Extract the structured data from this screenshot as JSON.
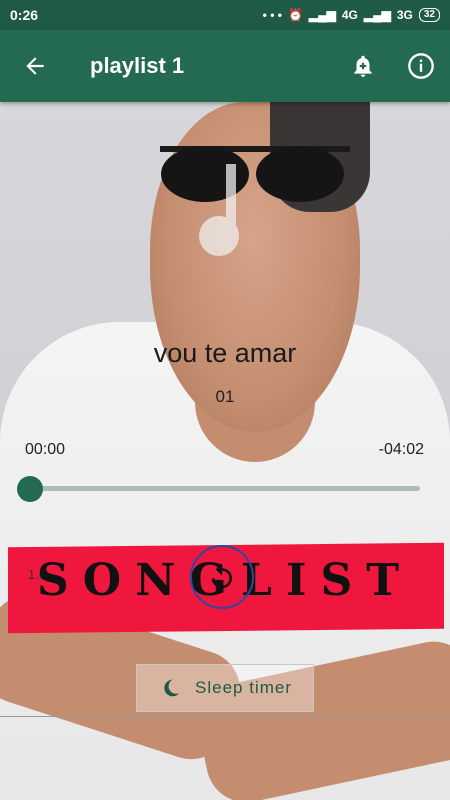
{
  "status_bar": {
    "time": "0:26",
    "dots": "• • •",
    "network1": "4G",
    "network2": "3G",
    "battery": "32"
  },
  "app_bar": {
    "title": "playlist 1"
  },
  "player": {
    "song_title": "vou te amar",
    "song_index": "01",
    "time_current": "00:00",
    "time_remaining": "-04:02",
    "progress": 0.0,
    "left_label": "1.0"
  },
  "banner": {
    "text": "SONGLIST"
  },
  "sleep_timer": {
    "label": "Sleep timer"
  },
  "colors": {
    "primary": "#236a50",
    "status": "#1f5a44",
    "banner": "#f0173e"
  }
}
